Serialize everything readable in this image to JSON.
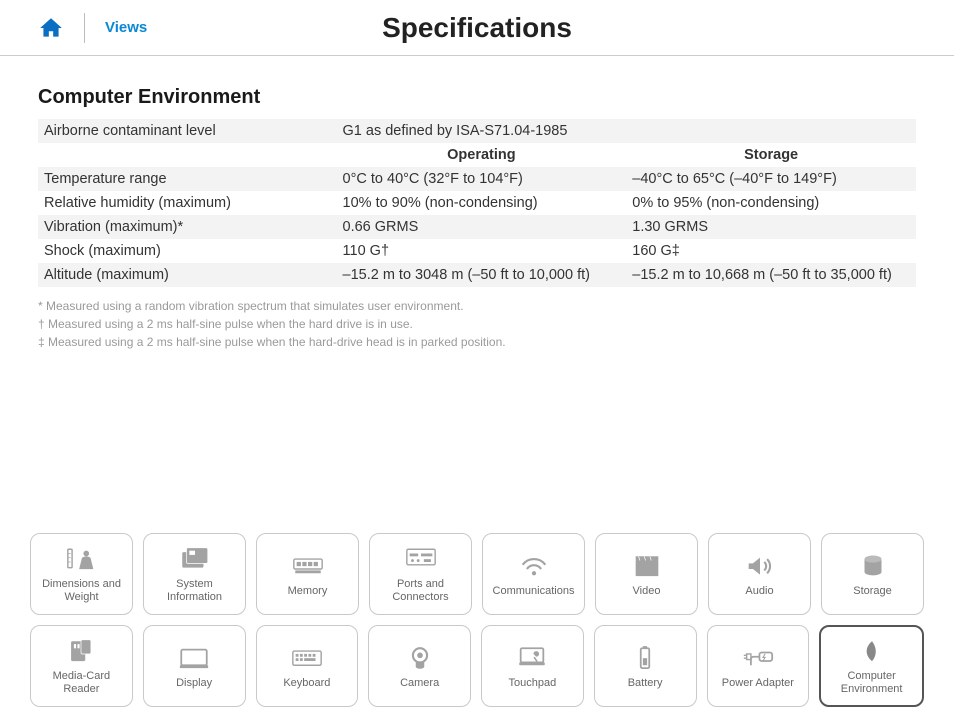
{
  "header": {
    "views_label": "Views",
    "title": "Specifications"
  },
  "section": {
    "title": "Computer Environment",
    "col_operating": "Operating",
    "col_storage": "Storage",
    "rows": {
      "contaminant_label": "Airborne contaminant level",
      "contaminant_value": "G1 as defined by ISA-S71.04-1985",
      "temp_label": "Temperature range",
      "temp_op": "0°C to 40°C (32°F to 104°F)",
      "temp_st": "–40°C to 65°C (–40°F to 149°F)",
      "humidity_label": "Relative humidity (maximum)",
      "humidity_op": "10% to 90% (non-condensing)",
      "humidity_st": "0% to 95% (non-condensing)",
      "vibration_label": "Vibration (maximum)*",
      "vibration_op": "0.66 GRMS",
      "vibration_st": "1.30 GRMS",
      "shock_label": "Shock (maximum)",
      "shock_op": "110 G†",
      "shock_st": "160 G‡",
      "altitude_label": "Altitude (maximum)",
      "altitude_op": "–15.2 m to 3048 m (–50 ft to 10,000 ft)",
      "altitude_st": "–15.2 m to 10,668 m (–50 ft to 35,000 ft)"
    },
    "footnotes": {
      "f1": "* Measured using a random vibration spectrum that simulates user environment.",
      "f2": "† Measured using a 2 ms half-sine pulse when the hard drive is in use.",
      "f3": "‡ Measured using a 2 ms half-sine pulse when the hard-drive head is in parked position."
    }
  },
  "tiles": {
    "r1": [
      "Dimensions and\nWeight",
      "System\nInformation",
      "Memory",
      "Ports and\nConnectors",
      "Communications",
      "Video",
      "Audio",
      "Storage"
    ],
    "r2": [
      "Media-Card\nReader",
      "Display",
      "Keyboard",
      "Camera",
      "Touchpad",
      "Battery",
      "Power Adapter",
      "Computer\nEnvironment"
    ],
    "active": "Computer\nEnvironment"
  }
}
